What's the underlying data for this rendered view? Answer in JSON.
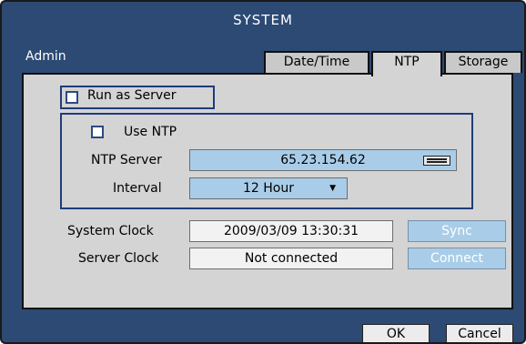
{
  "window": {
    "title": "SYSTEM"
  },
  "user": {
    "label": "Admin"
  },
  "tabs": [
    {
      "label": "Date/Time",
      "active": false
    },
    {
      "label": "NTP",
      "active": true
    },
    {
      "label": "Storage",
      "active": false
    }
  ],
  "ntp": {
    "run_as_server": {
      "label": "Run as Server",
      "checked": false
    },
    "use_ntp": {
      "label": "Use NTP",
      "checked": false
    },
    "server": {
      "label": "NTP Server",
      "value": "65.23.154.62"
    },
    "interval": {
      "label": "Interval",
      "value": "12 Hour"
    }
  },
  "clocks": {
    "system": {
      "label": "System Clock",
      "value": "2009/03/09  13:30:31",
      "button": "Sync"
    },
    "server": {
      "label": "Server Clock",
      "value": "Not connected",
      "button": "Connect"
    }
  },
  "footer": {
    "ok": "OK",
    "cancel": "Cancel"
  },
  "colors": {
    "window_bg": "#2c4a74",
    "panel_bg": "#d4d4d4",
    "field_blue": "#a9cde8",
    "border_blue": "#1e3c7a"
  },
  "icons": {
    "keyboard": "keyboard-icon",
    "dropdown": "chevron-down-icon"
  }
}
